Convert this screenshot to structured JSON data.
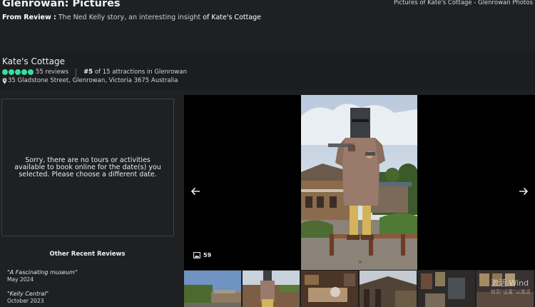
{
  "header": {
    "page_title": "Glenrowan: Pictures",
    "top_right": "Pictures of Kate's Cottage - Glenrowan Photos",
    "from_review_label": "From Review :",
    "review_title": "The Ned Kelly story, an interesting insight",
    "of_attraction": "of Kate's Cottage"
  },
  "attraction": {
    "name": "Kate's Cottage",
    "rating_bubbles": 5,
    "reviews": "55 reviews",
    "rank_number": "#5",
    "rank_text": "of 15 attractions in Glenrowan",
    "address": "35 Gladstone Street, Glenrowan, Victoria 3675 Australia"
  },
  "tours": {
    "message": "Sorry, there are no tours or activities available to book online for the date(s) you selected. Please choose a different date."
  },
  "recent_reviews": {
    "title": "Other Recent Reviews",
    "items": [
      {
        "quote": "\"A Fascinating museum\"",
        "date": "May 2024"
      },
      {
        "quote": "\"Kelly Central\"",
        "date": "October 2023"
      }
    ]
  },
  "viewer": {
    "photo_count": "59",
    "thumbnail_count": 6
  },
  "watermark": {
    "line1": "激活 Wind",
    "line2": "转到\"设置\"以激活"
  },
  "colors": {
    "background": "#1e2022",
    "rating_green": "#34e0a1",
    "viewer_bg": "#000000"
  },
  "icons": [
    "pin-icon",
    "arrow-left-icon",
    "arrow-right-icon",
    "image-stack-icon"
  ]
}
